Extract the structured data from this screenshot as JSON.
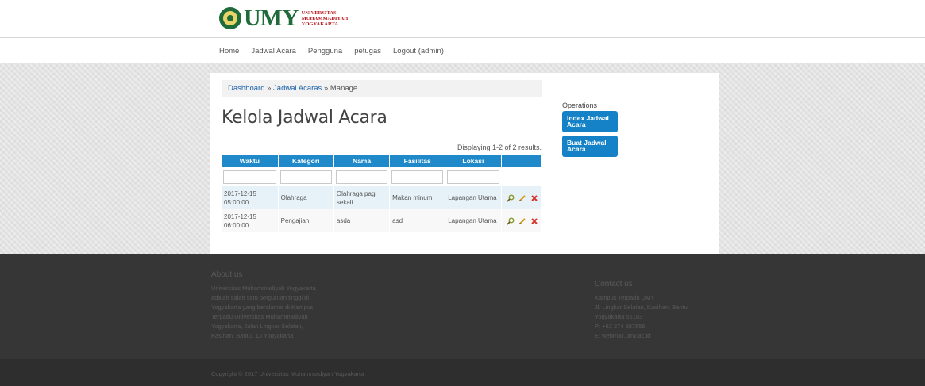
{
  "brand": {
    "umy": "UMY",
    "line1": "UNIVERSITAS",
    "line2": "MUHAMMADIYAH",
    "line3": "YOGYAKARTA"
  },
  "nav": [
    "Home",
    "Jadwal Acara",
    "Pengguna",
    "petugas",
    "Logout (admin)"
  ],
  "breadcrumb": {
    "dashboard": "Dashboard",
    "sep1": " » ",
    "jadwal": "Jadwal Acaras",
    "sep2": " » ",
    "current": "Manage"
  },
  "page_title": "Kelola Jadwal Acara",
  "summary": "Displaying 1-2 of 2 results.",
  "table": {
    "headers": [
      "Waktu",
      "Kategori",
      "Nama",
      "Fasilitas",
      "Lokasi",
      ""
    ],
    "rows": [
      [
        "2017-12-15 05:00:00",
        "Olahraga",
        "Olahraga pagi sekali",
        "Makan minum",
        "Lapangan Utama"
      ],
      [
        "2017-12-15 06:00:00",
        "Pengajian",
        "asda",
        "asd",
        "Lapangan Utama"
      ]
    ]
  },
  "operations": {
    "title": "Operations",
    "index": "Index Jadwal Acara",
    "create": "Buat Jadwal Acara"
  },
  "footer": {
    "about_title": "About us",
    "about_text": "Universitas Muhammadiyah Yogyakarta\nadalah salah satu perguruan tinggi di\nYogyakarta yang beralamat di Kampus\nTerpadu Universitas Muhammadiyah\nYogyakarta, Jalan Lingkar Selatan,\nKasihan, Bantul, DI Yogyakarta",
    "contact_title": "Contact us",
    "contact_text": "Kampus Terpadu UMY\nJl. Lingkar Selatan, Kasihan, Bantul\nYogyakarta 55183\nP: +62 274 387656\nE: webmail.umy.ac.id",
    "copyright": "Copyright © 2017 Universitas Muhammadiyah Yogyakarta"
  },
  "colors": {
    "accent": "#1f89c9",
    "button": "#1582c7",
    "footer": "#363636",
    "brand_green": "#1f6b3a",
    "brand_red": "#b4161b"
  },
  "icons": [
    "view-icon",
    "edit-icon",
    "delete-icon"
  ]
}
